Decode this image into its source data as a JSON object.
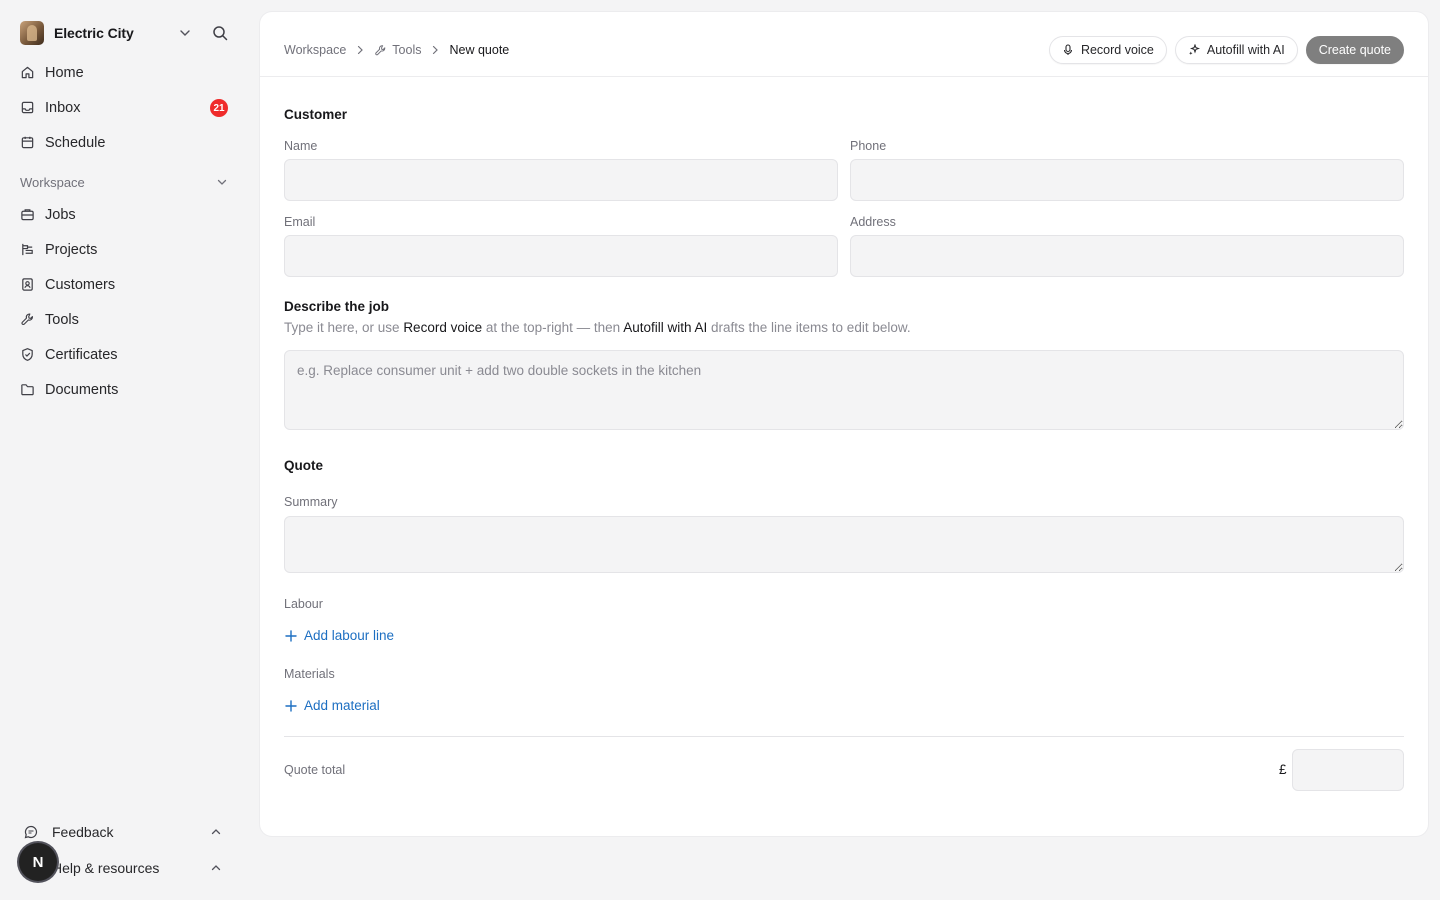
{
  "org": {
    "name": "Electric City"
  },
  "nav_top": [
    {
      "label": "Home",
      "icon": "home-icon"
    },
    {
      "label": "Inbox",
      "icon": "inbox-icon",
      "badge": "21"
    },
    {
      "label": "Schedule",
      "icon": "calendar-icon"
    }
  ],
  "workspace_label": "Workspace",
  "nav_workspace": [
    {
      "label": "Jobs",
      "icon": "briefcase-icon"
    },
    {
      "label": "Projects",
      "icon": "projects-icon"
    },
    {
      "label": "Customers",
      "icon": "contact-icon"
    },
    {
      "label": "Tools",
      "icon": "wrench-icon"
    },
    {
      "label": "Certificates",
      "icon": "shield-check-icon"
    },
    {
      "label": "Documents",
      "icon": "folder-icon"
    }
  ],
  "bottom": {
    "feedback": "Feedback",
    "help": "Help & resources",
    "user_initial": "N"
  },
  "breadcrumb": {
    "workspace": "Workspace",
    "tools": "Tools",
    "current": "New quote"
  },
  "actions": {
    "record": "Record voice",
    "autofill": "Autofill with AI",
    "create": "Create quote"
  },
  "customer": {
    "heading": "Customer",
    "name_label": "Name",
    "phone_label": "Phone",
    "email_label": "Email",
    "address_label": "Address",
    "name_value": "",
    "phone_value": "",
    "email_value": "",
    "address_value": ""
  },
  "job": {
    "heading": "Describe the job",
    "hint_pre": "Type it here, or use ",
    "hint_record": "Record voice",
    "hint_mid": " at the top-right — then ",
    "hint_autofill": "Autofill with AI",
    "hint_post": " drafts the line items to edit below.",
    "placeholder": "e.g. Replace consumer unit + add two double sockets in the kitchen"
  },
  "quote": {
    "heading": "Quote",
    "summary_label": "Summary",
    "labour_label": "Labour",
    "add_labour": "Add labour line",
    "materials_label": "Materials",
    "add_material": "Add material",
    "total_label": "Quote total",
    "currency": "£",
    "total_value": ""
  },
  "colors": {
    "accent_link": "#1d6fc2",
    "badge": "#ef2b2b",
    "primary_button": "#7f7f7f"
  }
}
